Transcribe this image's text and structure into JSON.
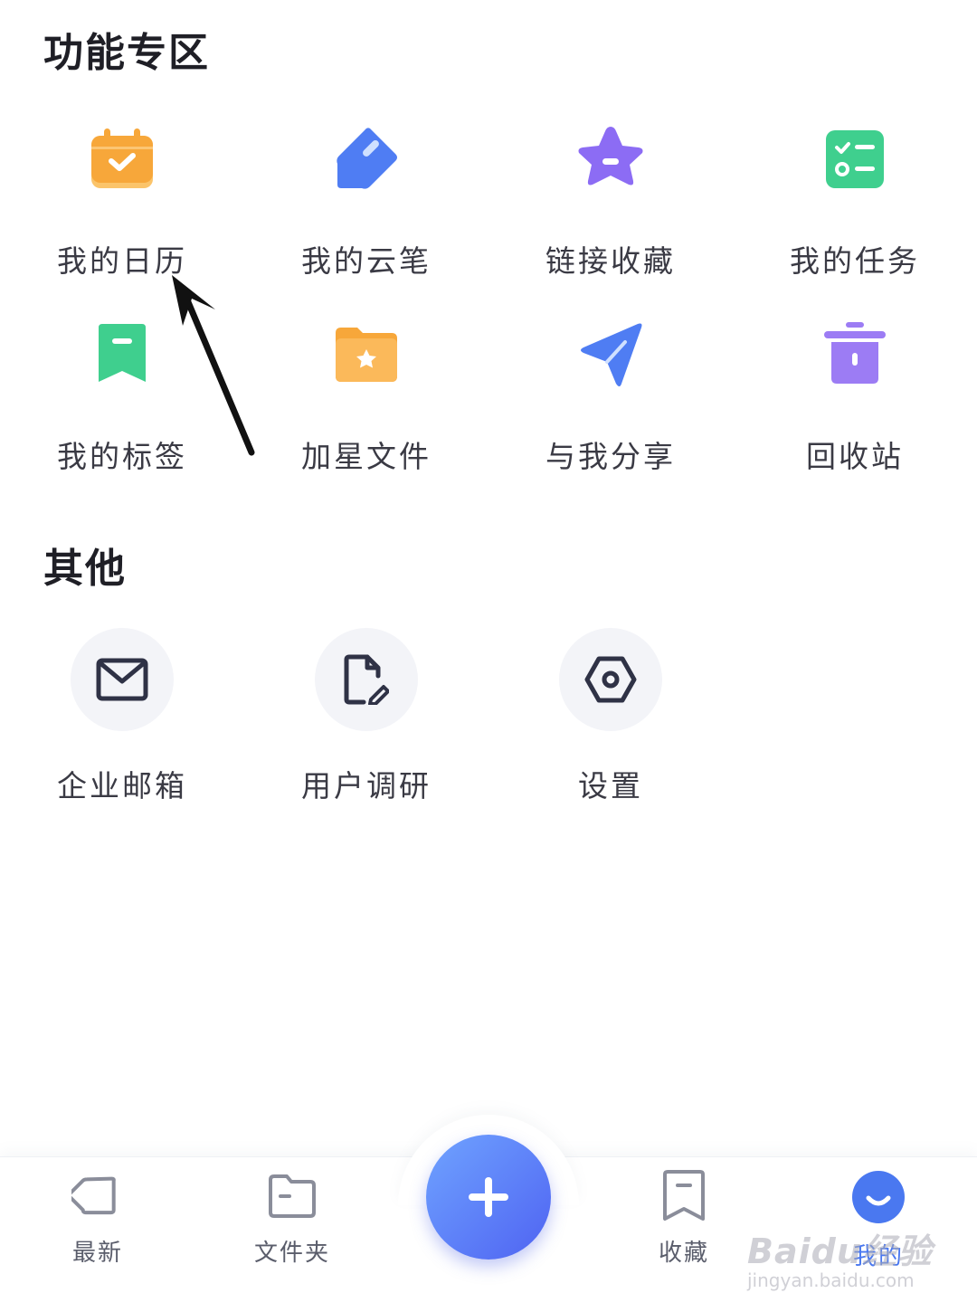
{
  "sections": {
    "features": {
      "title": "功能专区",
      "items": [
        {
          "label": "我的日历",
          "icon": "calendar-icon",
          "color": "#F7A73A"
        },
        {
          "label": "我的云笔",
          "icon": "cloud-pen-icon",
          "color": "#4F7DF3"
        },
        {
          "label": "链接收藏",
          "icon": "star-icon",
          "color": "#8C6CF4"
        },
        {
          "label": "我的任务",
          "icon": "task-list-icon",
          "color": "#3FCF8E"
        },
        {
          "label": "我的标签",
          "icon": "bookmark-tag-icon",
          "color": "#3FCF8E"
        },
        {
          "label": "加星文件",
          "icon": "starred-folder-icon",
          "color": "#F7A73A"
        },
        {
          "label": "与我分享",
          "icon": "send-share-icon",
          "color": "#4F7DF3"
        },
        {
          "label": "回收站",
          "icon": "trash-icon",
          "color": "#9C7CF4"
        }
      ]
    },
    "other": {
      "title": "其他",
      "items": [
        {
          "label": "企业邮箱",
          "icon": "mail-icon"
        },
        {
          "label": "用户调研",
          "icon": "survey-doc-icon"
        },
        {
          "label": "设置",
          "icon": "settings-hex-icon"
        }
      ]
    }
  },
  "bottom_nav": {
    "items": [
      {
        "label": "最新",
        "icon": "tag-icon"
      },
      {
        "label": "文件夹",
        "icon": "folder-icon"
      },
      {
        "label": "收藏",
        "icon": "bookmark-icon"
      },
      {
        "label": "我的",
        "icon": "profile-smile-icon",
        "active": true
      }
    ],
    "fab_icon": "plus-icon"
  },
  "watermark": {
    "main": "Baidu经验",
    "sub": "jingyan.baidu.com"
  },
  "colors": {
    "accent": "#4A78F0",
    "icon_dark": "#2F3246",
    "circle_bg": "#F3F4F8"
  }
}
